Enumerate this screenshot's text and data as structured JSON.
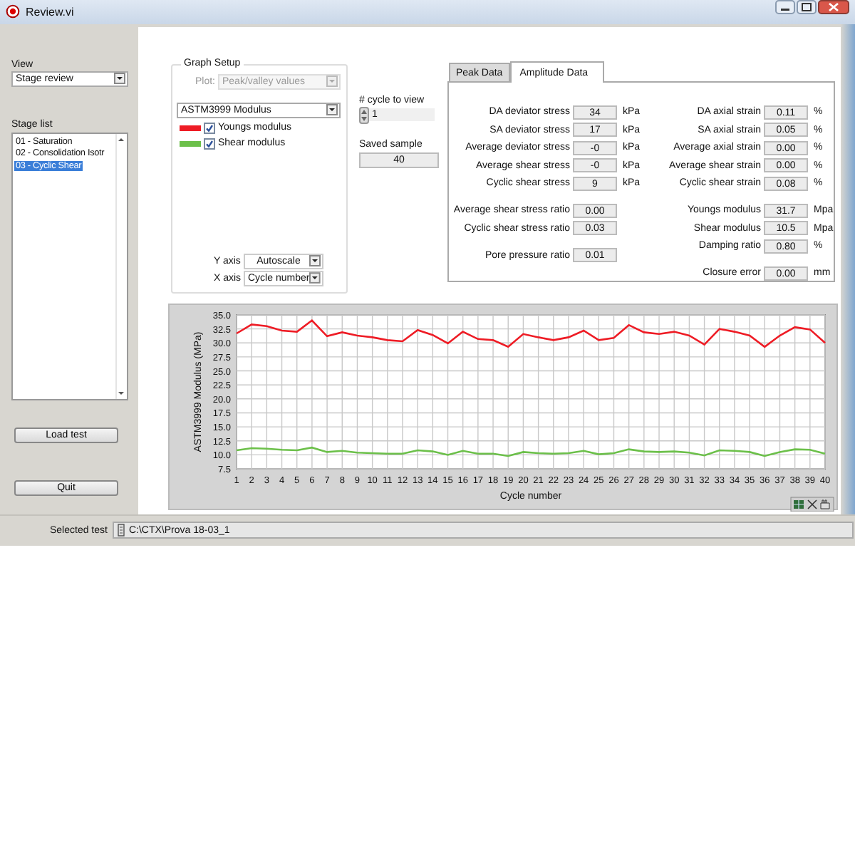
{
  "window": {
    "title": "Review.vi"
  },
  "view": {
    "label": "View",
    "value": "Stage review"
  },
  "stage_list": {
    "label": "Stage list",
    "items": [
      {
        "label": "01 - Saturation",
        "selected": false
      },
      {
        "label": "02 - Consolidation Isotr",
        "selected": false
      },
      {
        "label": "03 - Cyclic Shear",
        "selected": true
      }
    ]
  },
  "buttons": [
    {
      "label": "Load test"
    },
    {
      "label": "Quit"
    }
  ],
  "graph_setup": {
    "title": "Graph Setup",
    "plot": {
      "label": "Plot:",
      "value": "Peak/valley values",
      "disabled": true
    },
    "quantity": "ASTM3999 Modulus",
    "legend": [
      {
        "label": "Youngs modulus",
        "color": "#ee1c25",
        "checked": true
      },
      {
        "label": "Shear modulus",
        "color": "#6cc04a",
        "checked": true
      }
    ],
    "y_axis": {
      "label": "Y axis",
      "value": "Autoscale"
    },
    "x_axis": {
      "label": "X axis",
      "value": "Cycle number"
    }
  },
  "cycle_to_view": {
    "label": "# cycle to view",
    "value": "1"
  },
  "saved_sample": {
    "label": "Saved sample",
    "value": "40"
  },
  "tabs": [
    {
      "label": "Peak Data",
      "selected": false
    },
    {
      "label": "Amplitude Data",
      "selected": true
    }
  ],
  "amplitude": {
    "left_groups": [
      {
        "rows": [
          {
            "label": "DA deviator stress",
            "value": "34",
            "unit": "kPa"
          },
          {
            "label": "SA deviator stress",
            "value": "17",
            "unit": "kPa"
          },
          {
            "label": "Average deviator stress",
            "value": "-0",
            "unit": "kPa"
          },
          {
            "label": "Average shear stress",
            "value": "-0",
            "unit": "kPa"
          },
          {
            "label": "Cyclic shear stress",
            "value": "9",
            "unit": "kPa"
          }
        ]
      },
      {
        "rows": [
          {
            "label": "Average shear stress ratio",
            "value": "0.00"
          },
          {
            "label": "Cyclic shear stress ratio",
            "value": "0.03"
          }
        ]
      },
      {
        "rows": [
          {
            "label": "Pore pressure ratio",
            "value": "0.01"
          }
        ]
      }
    ],
    "right_groups": [
      {
        "rows": [
          {
            "label": "DA axial strain",
            "value": "0.11",
            "unit": "%"
          },
          {
            "label": "SA axial strain",
            "value": "0.05",
            "unit": "%"
          },
          {
            "label": "Average axial strain",
            "value": "0.00",
            "unit": "%"
          },
          {
            "label": "Average shear strain",
            "value": "0.00",
            "unit": "%"
          },
          {
            "label": "Cyclic shear strain",
            "value": "0.08",
            "unit": "%"
          }
        ]
      },
      {
        "rows": [
          {
            "label": "Youngs modulus",
            "value": "31.7",
            "unit": "Mpa"
          },
          {
            "label": "Shear modulus",
            "value": "10.5",
            "unit": "Mpa"
          },
          {
            "label": "Damping ratio",
            "value": "0.80",
            "unit": "%"
          }
        ]
      },
      {
        "rows": [
          {
            "label": "Closure error",
            "value": "0.00",
            "unit": "mm"
          }
        ]
      }
    ]
  },
  "chart": {
    "chart_data": {
      "type": "line",
      "grid": true,
      "xlabel": "Cycle number",
      "ylabel": "ASTM3999 Modulus (MPa)",
      "x": [
        1,
        2,
        3,
        4,
        5,
        6,
        7,
        8,
        9,
        10,
        11,
        12,
        13,
        14,
        15,
        16,
        17,
        18,
        19,
        20,
        21,
        22,
        23,
        24,
        25,
        26,
        27,
        28,
        29,
        30,
        31,
        32,
        33,
        34,
        35,
        36,
        37,
        38,
        39,
        40
      ],
      "xlim": [
        1,
        40
      ],
      "ylim": [
        7.5,
        35
      ],
      "xticks": [
        1,
        2,
        3,
        4,
        5,
        6,
        7,
        8,
        9,
        10,
        11,
        12,
        13,
        14,
        15,
        16,
        17,
        18,
        19,
        20,
        21,
        22,
        23,
        24,
        25,
        26,
        27,
        28,
        29,
        30,
        31,
        32,
        33,
        34,
        35,
        36,
        37,
        38,
        39,
        40
      ],
      "yticks": [
        {
          "value": 7.5,
          "label": "7.5"
        },
        {
          "value": 10,
          "label": "10.0"
        },
        {
          "value": 12.5,
          "label": "12.5"
        },
        {
          "value": 15,
          "label": "15.0"
        },
        {
          "value": 17.5,
          "label": "17.5"
        },
        {
          "value": 20,
          "label": "20.0"
        },
        {
          "value": 22.5,
          "label": "22.5"
        },
        {
          "value": 25,
          "label": "25.0"
        },
        {
          "value": 27.5,
          "label": "27.5"
        },
        {
          "value": 30,
          "label": "30.0"
        },
        {
          "value": 32.5,
          "label": "32.5"
        },
        {
          "value": 35,
          "label": "35.0"
        }
      ],
      "series": [
        {
          "color": "#ee1c25",
          "values": [
            31.7,
            33.3,
            33.0,
            32.2,
            32.0,
            34.0,
            31.2,
            31.9,
            31.3,
            31.0,
            30.5,
            30.3,
            32.3,
            31.4,
            29.9,
            32.0,
            30.7,
            30.5,
            29.3,
            31.6,
            31.0,
            30.5,
            31.0,
            32.2,
            30.5,
            30.9,
            33.2,
            31.9,
            31.6,
            32.0,
            31.3,
            29.7,
            32.5,
            32.0,
            31.3,
            29.3,
            31.3,
            32.8,
            32.4,
            30.0
          ]
        },
        {
          "color": "#6cc04a",
          "values": [
            10.8,
            11.2,
            11.1,
            10.9,
            10.8,
            11.3,
            10.5,
            10.7,
            10.4,
            10.3,
            10.2,
            10.2,
            10.8,
            10.6,
            10.0,
            10.7,
            10.2,
            10.2,
            9.8,
            10.5,
            10.3,
            10.2,
            10.3,
            10.7,
            10.1,
            10.3,
            11.0,
            10.6,
            10.5,
            10.6,
            10.4,
            9.9,
            10.8,
            10.7,
            10.5,
            9.8,
            10.5,
            11.0,
            10.9,
            10.2
          ]
        }
      ]
    }
  },
  "status": {
    "label": "Selected test",
    "value": "C:\\CTX\\Prova 18-03_1"
  }
}
